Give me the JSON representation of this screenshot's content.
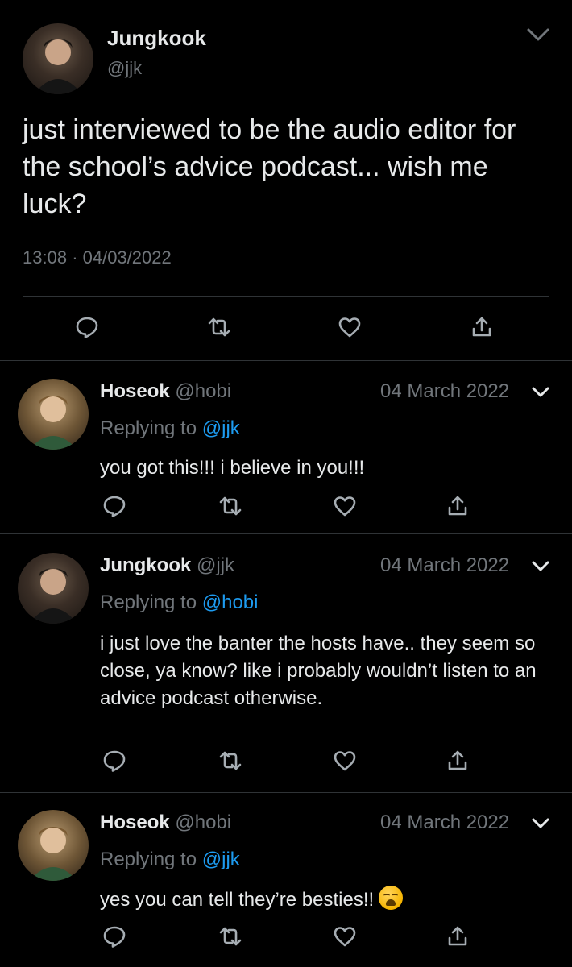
{
  "main_tweet": {
    "name": "Jungkook",
    "handle": "@jjk",
    "text": "just interviewed to be the audio editor for the school’s advice podcast... wish me luck?",
    "time": "13:08",
    "separator": "·",
    "date": "04/03/2022"
  },
  "replies": [
    {
      "name": "Hoseok",
      "handle": "@hobi",
      "date": "04 March 2022",
      "replying_label": "Replying to",
      "replying_to": "@jjk",
      "text": "you got this!!! i believe in you!!!"
    },
    {
      "name": "Jungkook",
      "handle": "@jjk",
      "date": "04 March 2022",
      "replying_label": "Replying to",
      "replying_to": "@hobi",
      "text": "i just love the banter the hosts have.. they seem so close, ya know? like i probably wouldn’t listen to an advice podcast otherwise."
    },
    {
      "name": "Hoseok",
      "handle": "@hobi",
      "date": "04 March 2022",
      "replying_label": "Replying to",
      "replying_to": "@jjk",
      "text": "yes you can tell they’re besties!!",
      "emoji": "weary-face-emoji"
    }
  ],
  "icons": [
    "reply-icon",
    "retweet-icon",
    "like-icon",
    "share-icon",
    "chevron-down-icon"
  ],
  "colors": {
    "background": "#000000",
    "text": "#e7e9ea",
    "muted": "#71767b",
    "link": "#1d9bf0",
    "divider": "#2f3336"
  }
}
